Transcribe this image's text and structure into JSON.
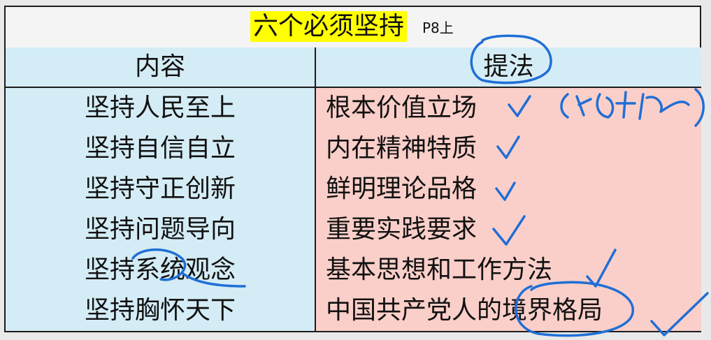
{
  "title": "六个必须坚持",
  "page_ref": "P8上",
  "headers": {
    "content": "内容",
    "formulation": "提法"
  },
  "rows": [
    {
      "content": "坚持人民至上",
      "formulation": "根本价值立场"
    },
    {
      "content": "坚持自信自立",
      "formulation": "内在精神特质"
    },
    {
      "content": "坚持守正创新",
      "formulation": "鲜明理论品格"
    },
    {
      "content": "坚持问题导向",
      "formulation": "重要实践要求"
    },
    {
      "content": "坚持系统观念",
      "formulation": "基本思想和工作方法"
    },
    {
      "content": "坚持胸怀天下",
      "formulation": "中国共产党人的境界格局"
    }
  ],
  "colors": {
    "title_highlight": "#ffff00",
    "left_column": "#d4ecf5",
    "right_column": "#fbcfc9",
    "annotation_ink": "#1f6fd6"
  }
}
